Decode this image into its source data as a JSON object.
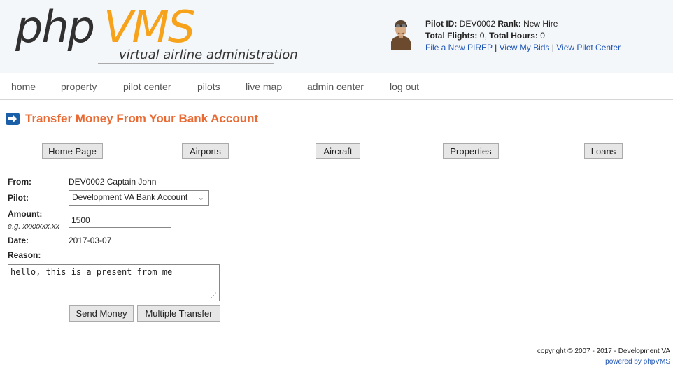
{
  "logo": {
    "part1": "php",
    "part2": "VMS",
    "subtitle": "virtual airline administration"
  },
  "pilot": {
    "id_label": "Pilot ID:",
    "id": "DEV0002",
    "rank_label": "Rank:",
    "rank": "New Hire",
    "flights_label": "Total Flights:",
    "flights": "0,",
    "hours_label": "Total Hours:",
    "hours": "0",
    "links": [
      "File a New PIREP",
      "View My Bids",
      "View Pilot Center"
    ],
    "separator": "|"
  },
  "nav": [
    "home",
    "property",
    "pilot center",
    "pilots",
    "live map",
    "admin center",
    "log out"
  ],
  "page_title": "Transfer Money From Your Bank Account",
  "top_buttons": [
    "Home Page",
    "Airports",
    "Aircraft",
    "Properties",
    "Loans"
  ],
  "form": {
    "from_label": "From:",
    "from_value": "DEV0002 Captain John",
    "pilot_label": "Pilot:",
    "pilot_value": "Development VA Bank Account",
    "amount_label": "Amount:",
    "amount_hint": "e.g. xxxxxxx.xx",
    "amount_value": "1500",
    "date_label": "Date:",
    "date_value": "2017-03-07",
    "reason_label": "Reason:",
    "reason_value": "hello, this is a present from me"
  },
  "submit_buttons": [
    "Send Money",
    "Multiple Transfer"
  ],
  "footer": {
    "copyright": "copyright © 2007 - 2017 - Development VA",
    "powered": "powered by phpVMS"
  },
  "colors": {
    "title": "#ea6a33",
    "logo_accent": "#f7a21b",
    "link": "#1f55b5"
  }
}
